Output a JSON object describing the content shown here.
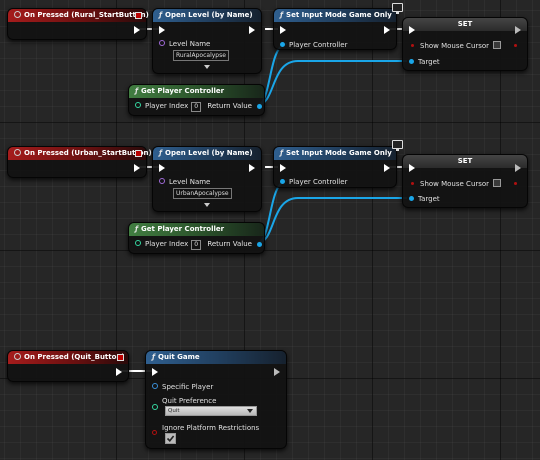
{
  "graph": {
    "colors": {
      "exec_wire": "#ffffff",
      "object_wire": "#1aa6e8",
      "event_header": "#a51c1c",
      "function_header": "#2f5f8f",
      "pure_header": "#417d41",
      "set_header": "#3a3a3a"
    },
    "group_rural": {
      "event_title": "On Pressed (Rural_StartButton)",
      "open_level": {
        "title": "Open Level (by Name)",
        "level_name_label": "Level Name",
        "level_name_value": "RuralApocalypse"
      },
      "set_input_mode": {
        "title": "Set Input Mode Game Only",
        "player_controller_label": "Player Controller"
      },
      "set_node": {
        "title": "SET",
        "show_mouse_cursor_label": "Show Mouse Cursor",
        "target_label": "Target"
      },
      "get_player_controller": {
        "title": "Get Player Controller",
        "player_index_label": "Player Index",
        "player_index_value": "0",
        "return_value_label": "Return Value"
      }
    },
    "group_urban": {
      "event_title": "On Pressed (Urban_StartButton)",
      "open_level": {
        "title": "Open Level (by Name)",
        "level_name_label": "Level Name",
        "level_name_value": "UrbanApocalypse"
      },
      "set_input_mode": {
        "title": "Set Input Mode Game Only",
        "player_controller_label": "Player Controller"
      },
      "set_node": {
        "title": "SET",
        "show_mouse_cursor_label": "Show Mouse Cursor",
        "target_label": "Target"
      },
      "get_player_controller": {
        "title": "Get Player Controller",
        "player_index_label": "Player Index",
        "player_index_value": "0",
        "return_value_label": "Return Value"
      }
    },
    "group_quit": {
      "event_title": "On Pressed (Quit_Button)",
      "quit_game": {
        "title": "Quit Game",
        "specific_player_label": "Specific Player",
        "quit_preference_label": "Quit Preference",
        "quit_preference_value": "Quit",
        "ignore_platform_label": "Ignore Platform Restrictions",
        "ignore_platform_checked": true
      }
    }
  }
}
